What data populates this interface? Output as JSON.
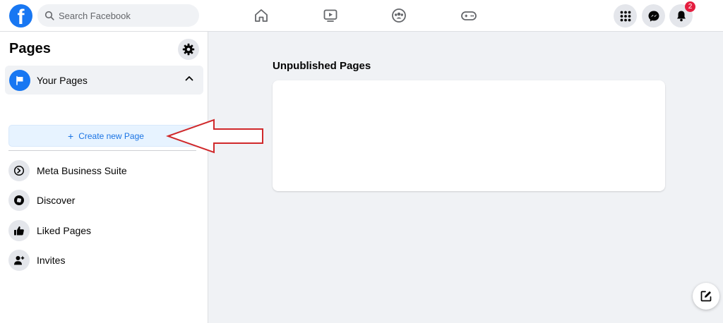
{
  "topbar": {
    "logo": "f",
    "search_placeholder": "Search Facebook",
    "nav_icons": [
      "home-icon",
      "watch-icon",
      "groups-icon",
      "gaming-icon"
    ],
    "right_buttons": [
      "menu-grid-icon",
      "messenger-icon",
      "bell-icon"
    ],
    "notification_count": "2"
  },
  "sidebar": {
    "title": "Pages",
    "your_pages_label": "Your Pages",
    "create_label": "Create new Page",
    "create_plus": "+",
    "items": [
      {
        "label": "Meta Business Suite",
        "icon": "meta-business-icon"
      },
      {
        "label": "Discover",
        "icon": "discover-icon"
      },
      {
        "label": "Liked Pages",
        "icon": "thumbs-up-icon"
      },
      {
        "label": "Invites",
        "icon": "person-add-icon"
      }
    ]
  },
  "main": {
    "section_title": "Unpublished Pages"
  },
  "colors": {
    "brand": "#1877f2",
    "create_button_bg": "#e7f3ff",
    "create_button_text": "#1b74e4",
    "badge": "#e41e3f",
    "annotation_arrow": "#d0292b"
  }
}
